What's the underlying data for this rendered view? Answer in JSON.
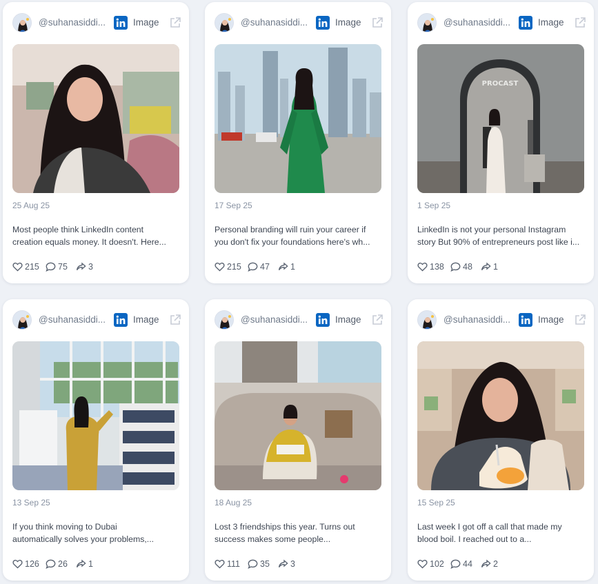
{
  "posts": [
    {
      "handle": "@suhanasiddi...",
      "platform": "LinkedIn",
      "type": "Image",
      "date": "25 Aug 25",
      "text_line1": "Most people think LinkedIn content",
      "text_line2": "creation equals money. It doesn't. Here...",
      "likes": "215",
      "comments": "75",
      "shares": "3"
    },
    {
      "handle": "@suhanasiddi...",
      "platform": "LinkedIn",
      "type": "Image",
      "date": "17 Sep 25",
      "text_line1": "Personal branding will ruin your career if",
      "text_line2": "you don't fix your foundations here's wh...",
      "likes": "215",
      "comments": "47",
      "shares": "1"
    },
    {
      "handle": "@suhanasiddi...",
      "platform": "LinkedIn",
      "type": "Image",
      "date": "1 Sep 25",
      "text_line1": "LinkedIn is not your personal Instagram",
      "text_line2": "story But 90% of entrepreneurs post like i...",
      "likes": "138",
      "comments": "48",
      "shares": "1",
      "sign_text": "PROCAST"
    },
    {
      "handle": "@suhanasiddi...",
      "platform": "LinkedIn",
      "type": "Image",
      "date": "13 Sep 25",
      "text_line1": "If you think moving to Dubai",
      "text_line2": "automatically solves your problems,...",
      "likes": "126",
      "comments": "26",
      "shares": "1"
    },
    {
      "handle": "@suhanasiddi...",
      "platform": "LinkedIn",
      "type": "Image",
      "date": "18 Aug 25",
      "text_line1": "Lost 3 friendships this year. Turns out",
      "text_line2": "success makes some people...",
      "likes": "111",
      "comments": "35",
      "shares": "3"
    },
    {
      "handle": "@suhanasiddi...",
      "platform": "LinkedIn",
      "type": "Image",
      "date": "15 Sep 25",
      "text_line1": "Last week I got off a call that made my",
      "text_line2": "blood boil. I reached out to a...",
      "likes": "102",
      "comments": "44",
      "shares": "2"
    }
  ],
  "colors": {
    "linkedin": "#0a66c2",
    "card": "#ffffff",
    "background": "#eef1f6"
  },
  "icons": {
    "like": "heart-icon",
    "comment": "comment-icon",
    "share": "share-icon",
    "external": "external-link-icon"
  }
}
